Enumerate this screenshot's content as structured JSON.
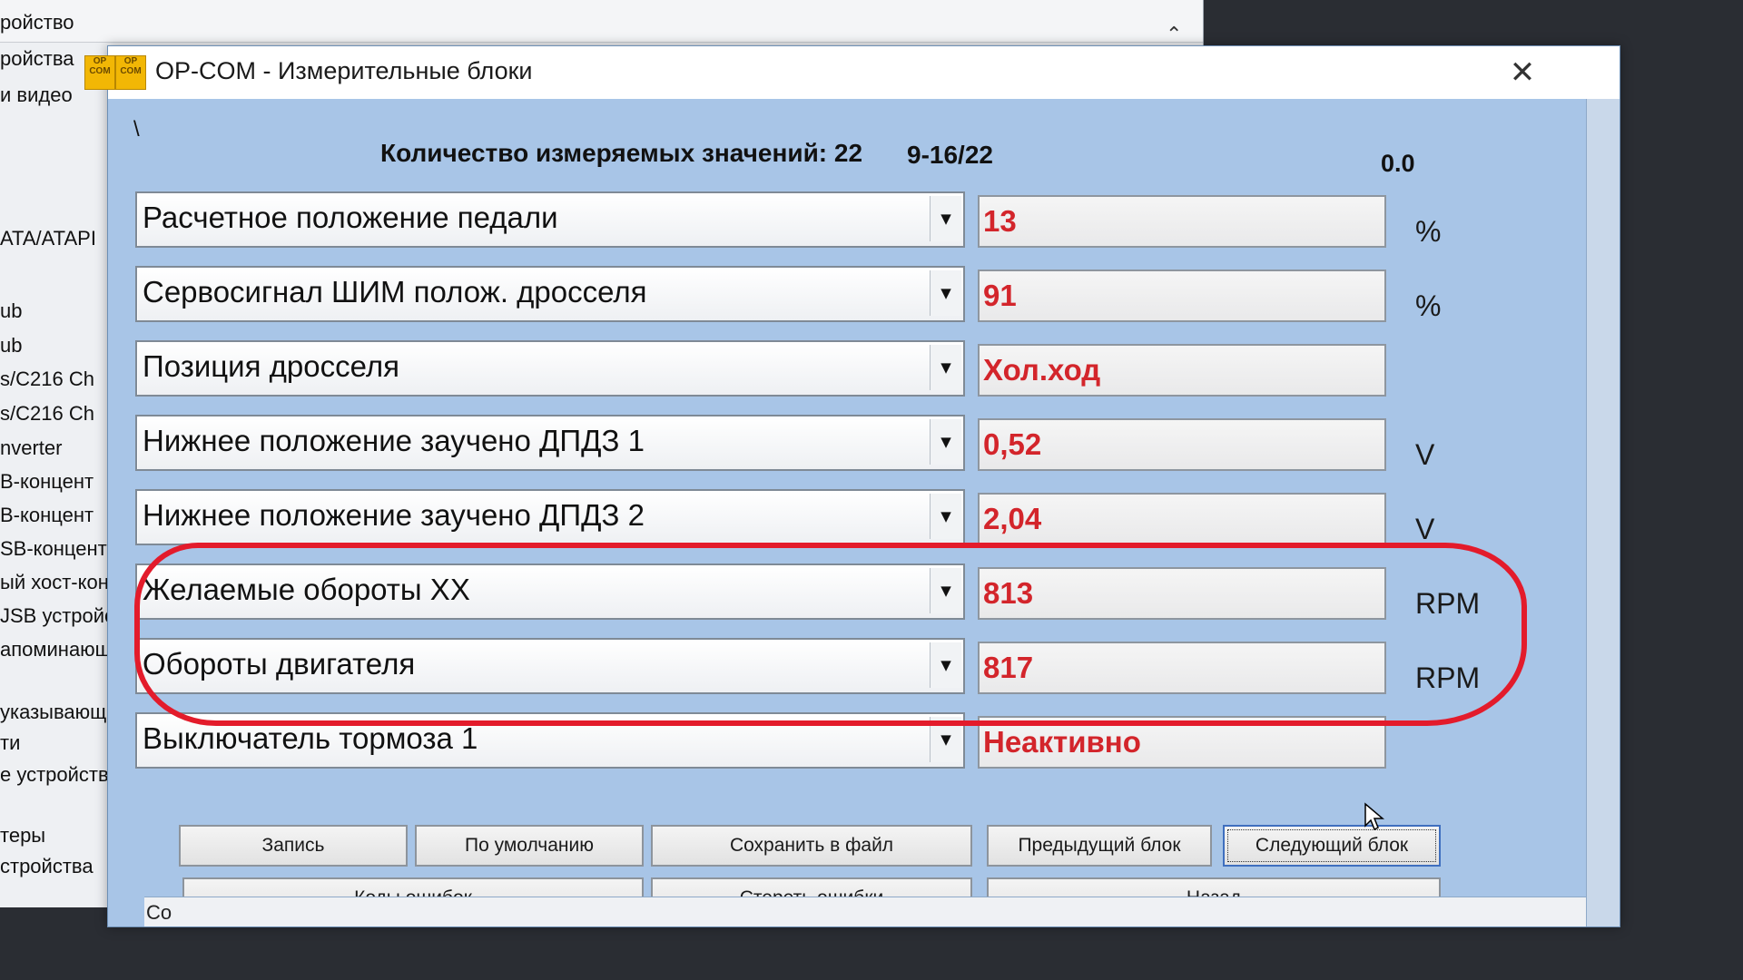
{
  "background_window": {
    "items": [
      "ройство",
      "ройства",
      "и видео",
      "ATA/ATAPI",
      "ub",
      "ub",
      "s/C216 Ch",
      "s/C216 Ch",
      "nverter",
      "B-концент",
      "B-концент",
      "SB-концент",
      "ый хост-кон",
      "JSB устройс",
      "апоминающ",
      "указывающ",
      "ти",
      "е устройства",
      "теры",
      "стройства"
    ]
  },
  "window": {
    "title": "OP-COM - Измерительные блоки",
    "icon_text": "OP COM"
  },
  "header": {
    "slash": "\\",
    "count_label": "Количество измеряемых значений: 22",
    "range": "9-16/22",
    "value": "0.0"
  },
  "rows": [
    {
      "label": "Расчетное положение педали",
      "value": "13",
      "unit": "%"
    },
    {
      "label": "Сервосигнал ШИМ полож. дросселя",
      "value": "91",
      "unit": "%"
    },
    {
      "label": "Позиция дросселя",
      "value": "Хол.ход",
      "unit": ""
    },
    {
      "label": "Нижнее положение заучено ДПДЗ 1",
      "value": "0,52",
      "unit": "V"
    },
    {
      "label": "Нижнее положение заучено ДПДЗ 2",
      "value": "2,04",
      "unit": "V"
    },
    {
      "label": "Желаемые обороты ХХ",
      "value": "813",
      "unit": "RPM"
    },
    {
      "label": "Обороты двигателя",
      "value": "817",
      "unit": "RPM"
    },
    {
      "label": "Выключатель тормоза 1",
      "value": "Неактивно",
      "unit": ""
    }
  ],
  "buttons": {
    "record": "Запись",
    "default": "По умолчанию",
    "save_file": "Сохранить в файл",
    "prev_block": "Предыдущий блок",
    "next_block": "Следующий блок",
    "error_codes": "Коды ошибок",
    "clear_errors": "Стереть ошибки",
    "back": "Назад"
  },
  "status": {
    "text": "Co"
  },
  "colors": {
    "value_text": "#d3252b",
    "window_bg": "#a8c5e7",
    "annotation": "#e31b2b"
  }
}
